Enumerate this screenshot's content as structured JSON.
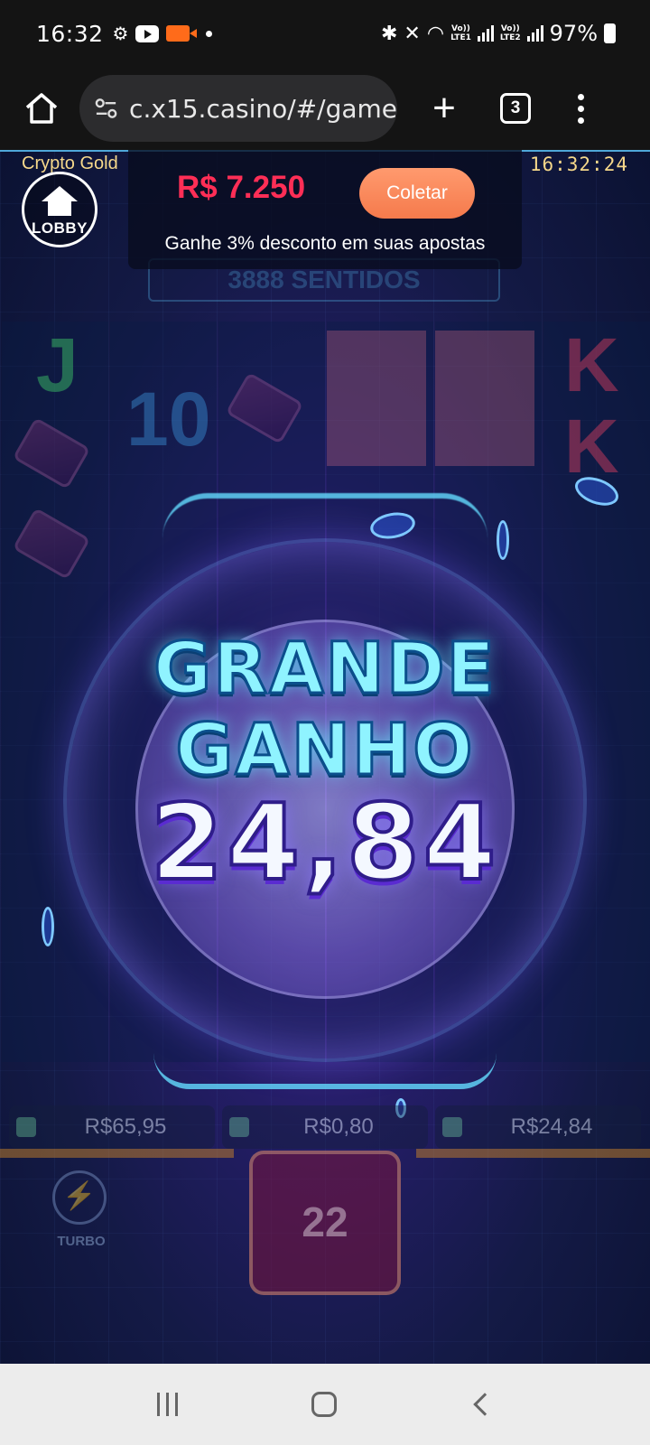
{
  "status_bar": {
    "time": "16:32",
    "lte1": "LTE1",
    "lte2": "LTE2",
    "vo_label": "Vo))",
    "battery_percent": "97%",
    "icons": [
      "robot-icon",
      "youtube-icon",
      "screen-record-icon",
      "notification-dot-icon",
      "bluetooth-icon",
      "mute-icon",
      "wifi-icon",
      "signal-icon",
      "battery-charging-icon"
    ]
  },
  "browser": {
    "url": "c.x15.casino/#/game",
    "tab_count": "3",
    "icons": [
      "home-icon",
      "site-settings-icon",
      "new-tab-icon",
      "tabs-icon",
      "menu-icon"
    ]
  },
  "game": {
    "name": "Crypto Gold",
    "clock": "16:32:24",
    "lobby_label": "LOBBY",
    "brand_plate": "3888 SENTIDOS",
    "promo": {
      "amount": "R$ 7.250",
      "collect_label": "Coletar",
      "subtitle": "Ganhe 3% desconto em suas apostas"
    },
    "win": {
      "line1": "GRANDE",
      "line2": "GANHO",
      "amount": "24,84"
    },
    "reel_symbols": [
      "J",
      "10",
      "K",
      "K"
    ],
    "stats": [
      "R$65,95",
      "R$0,80",
      "R$24,84"
    ],
    "spins_remaining": "22",
    "turbo_label": "TURBO",
    "colors": {
      "promo_amount": "#ff2e56",
      "collect_button": "#f57a4c",
      "header_text": "#f6d88b",
      "win_title": "#8ff3ff"
    }
  },
  "nav_bar": {
    "icons": [
      "recent-apps-icon",
      "home-icon",
      "back-icon"
    ]
  }
}
